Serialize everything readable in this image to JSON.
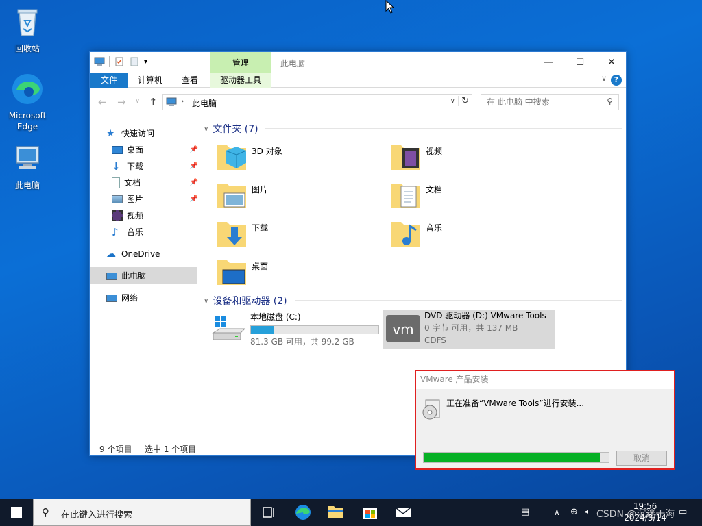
{
  "desktop": {
    "icons": [
      {
        "label": "回收站"
      },
      {
        "label": "Microsoft Edge"
      },
      {
        "label": "此电脑"
      }
    ]
  },
  "explorer": {
    "title": "此电脑",
    "context_tab": "管理",
    "ribbon_tabs": [
      "文件",
      "计算机",
      "查看",
      "驱动器工具"
    ],
    "address": {
      "crumb": "此电脑"
    },
    "search": {
      "placeholder": "在 此电脑 中搜索"
    },
    "nav": {
      "quick_access": "快速访问",
      "items": [
        "桌面",
        "下载",
        "文档",
        "图片",
        "视频",
        "音乐"
      ],
      "onedrive": "OneDrive",
      "this_pc": "此电脑",
      "network": "网络"
    },
    "folders_header": "文件夹 (7)",
    "folders": [
      "3D 对象",
      "视频",
      "图片",
      "文档",
      "下载",
      "音乐",
      "桌面"
    ],
    "devices_header": "设备和驱动器 (2)",
    "drives": [
      {
        "name": "本地磁盘 (C:)",
        "info": "81.3 GB 可用，共 99.2 GB",
        "used_fraction": 0.18
      },
      {
        "name": "DVD 驱动器 (D:) VMware Tools",
        "info": "0 字节 可用，共 137 MB",
        "fs": "CDFS"
      }
    ],
    "status": {
      "count": "9 个项目",
      "selected": "选中 1 个项目"
    }
  },
  "vmware_dialog": {
    "title": "VMware 产品安装",
    "message": "正在准备“VMware Tools”进行安装...",
    "progress": 0.95,
    "cancel_label": "取消"
  },
  "taskbar": {
    "search_text": "在此键入进行搜索",
    "time": "19:56",
    "date": "2024/3/14",
    "watermark": "CSDN @沉迷于海"
  }
}
